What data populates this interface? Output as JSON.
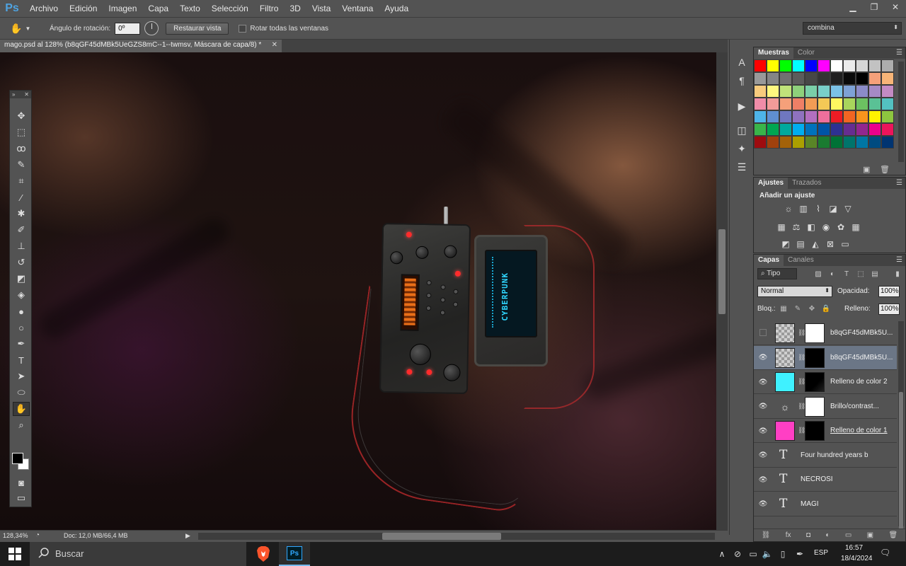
{
  "app": {
    "logo": "Ps",
    "menu": [
      "Archivo",
      "Edición",
      "Imagen",
      "Capa",
      "Texto",
      "Selección",
      "Filtro",
      "3D",
      "Vista",
      "Ventana",
      "Ayuda"
    ],
    "window_controls": [
      "minimize-icon",
      "restore-icon",
      "close-icon"
    ]
  },
  "options_bar": {
    "tool_icon": "rotate-view-icon",
    "angle_label": "Ángulo de rotación:",
    "angle_value": "0º",
    "reset_button": "Restaurar vista",
    "rotate_all_label": "Rotar todas las ventanas",
    "rotate_all_checked": false,
    "workspace": "combina"
  },
  "document": {
    "tab_title": "mago.psd al 128% (b8qGF45dMBk5UeGZS8mC--1--twmsv, Máscara de capa/8) *",
    "device_screen_text": "CYBERPUNK"
  },
  "status_bar": {
    "zoom": "128,34%",
    "doc_info": "Doc: 12,0 MB/66,4 MB"
  },
  "tools": [
    {
      "name": "move-tool-icon",
      "glyph": "✥"
    },
    {
      "name": "marquee-tool-icon",
      "glyph": "⬚"
    },
    {
      "name": "lasso-tool-icon",
      "glyph": "ꝏ"
    },
    {
      "name": "quick-select-tool-icon",
      "glyph": "✎"
    },
    {
      "name": "crop-tool-icon",
      "glyph": "⌗"
    },
    {
      "name": "eyedropper-tool-icon",
      "glyph": "⁄"
    },
    {
      "name": "healing-brush-tool-icon",
      "glyph": "✱"
    },
    {
      "name": "brush-tool-icon",
      "glyph": "✐"
    },
    {
      "name": "clone-stamp-tool-icon",
      "glyph": "⊥"
    },
    {
      "name": "history-brush-tool-icon",
      "glyph": "↺"
    },
    {
      "name": "eraser-tool-icon",
      "glyph": "◩"
    },
    {
      "name": "paint-bucket-tool-icon",
      "glyph": "◈"
    },
    {
      "name": "blur-tool-icon",
      "glyph": "●"
    },
    {
      "name": "dodge-tool-icon",
      "glyph": "○"
    },
    {
      "name": "pen-tool-icon",
      "glyph": "✒"
    },
    {
      "name": "type-tool-icon",
      "glyph": "T"
    },
    {
      "name": "path-select-tool-icon",
      "glyph": "➤"
    },
    {
      "name": "ellipse-tool-icon",
      "glyph": "⬭"
    },
    {
      "name": "hand-rotate-tool-icon",
      "glyph": "✋"
    },
    {
      "name": "zoom-tool-icon",
      "glyph": "⌕"
    }
  ],
  "swatches_panel": {
    "tabs": [
      "Muestras",
      "Color"
    ],
    "colors": [
      "#ff0000",
      "#ffff00",
      "#00ff00",
      "#00ffff",
      "#0000ff",
      "#ff00ff",
      "#ffffff",
      "#ebebeb",
      "#d6d6d6",
      "#c2c2c2",
      "#adadad",
      "#999999",
      "#858585",
      "#707070",
      "#5c5c5c",
      "#474747",
      "#333333",
      "#1f1f1f",
      "#0a0a0a",
      "#000000",
      "#f5a07a",
      "#f7b477",
      "#f8cb7d",
      "#fff77f",
      "#c0e37a",
      "#8ed17b",
      "#7acfa8",
      "#79cfc9",
      "#7bc2e6",
      "#7ea2d6",
      "#8b8bc7",
      "#a68ac5",
      "#c38bc4",
      "#f08ca8",
      "#f39b99",
      "#f5a07a",
      "#ef7f66",
      "#f19c55",
      "#f4c856",
      "#fff660",
      "#a9d55c",
      "#6cc161",
      "#5ac195",
      "#53c1c1",
      "#4eb4e8",
      "#5f8fd1",
      "#6f77c0",
      "#8f72bf",
      "#b26fbf",
      "#ee6f9c",
      "#ed1c24",
      "#f26522",
      "#f7941d",
      "#fff200",
      "#8dc63f",
      "#39b54a",
      "#00a651",
      "#00a99d",
      "#00aeef",
      "#0072bc",
      "#0054a6",
      "#2e3192",
      "#662d91",
      "#92278f",
      "#ec008c",
      "#ed145b",
      "#9e0b0f",
      "#a0410d",
      "#a36209",
      "#aba000",
      "#598527",
      "#1a7b30",
      "#007236",
      "#00746b",
      "#0076a3",
      "#004b80",
      "#003471"
    ]
  },
  "adjustments_panel": {
    "tabs": [
      "Ajustes",
      "Trazados"
    ],
    "title": "Añadir un ajuste",
    "rows": [
      [
        "brightness-contrast-icon",
        "levels-icon",
        "curves-icon",
        "exposure-icon",
        "vibrance-icon"
      ],
      [
        "hue-saturation-icon",
        "color-balance-icon",
        "black-white-icon",
        "photo-filter-icon",
        "channel-mixer-icon",
        "color-lookup-icon"
      ],
      [
        "invert-icon",
        "posterize-icon",
        "threshold-icon",
        "selective-color-icon",
        "gradient-map-icon"
      ]
    ]
  },
  "layers_panel": {
    "tabs": [
      "Capas",
      "Canales"
    ],
    "filter_label": "Tipo",
    "blend_mode": "Normal",
    "opacity_label": "Opacidad:",
    "opacity_value": "100%",
    "lock_label": "Bloq.:",
    "fill_label": "Relleno:",
    "fill_value": "100%",
    "layers": [
      {
        "name": "b8qGF45dMBk5U...",
        "visible": false,
        "type": "smart",
        "mask": "white",
        "selected": false
      },
      {
        "name": "b8qGF45dMBk5U...",
        "visible": true,
        "type": "smart",
        "mask": "black",
        "selected": true
      },
      {
        "name": "Relleno de color 2",
        "visible": true,
        "type": "fill",
        "fill": "#3ff1ff",
        "mask": "black-grad",
        "selected": false
      },
      {
        "name": "Brillo/contrast...",
        "visible": true,
        "type": "adjust",
        "mask": "white",
        "selected": false
      },
      {
        "name": "Relleno de color 1",
        "visible": true,
        "type": "fill",
        "fill": "#ff3fc4",
        "mask": "black",
        "selected": false
      },
      {
        "name": "Four hundred years before t...",
        "visible": true,
        "type": "text",
        "selected": false
      },
      {
        "name": "NECROSI",
        "visible": true,
        "type": "text",
        "selected": false
      },
      {
        "name": "MAGI",
        "visible": true,
        "type": "text",
        "selected": false
      }
    ]
  },
  "taskbar": {
    "search_placeholder": "Buscar",
    "language": "ESP",
    "time": "16:57",
    "date": "18/4/2024",
    "apps": [
      "brave-icon",
      "photoshop-icon"
    ]
  }
}
